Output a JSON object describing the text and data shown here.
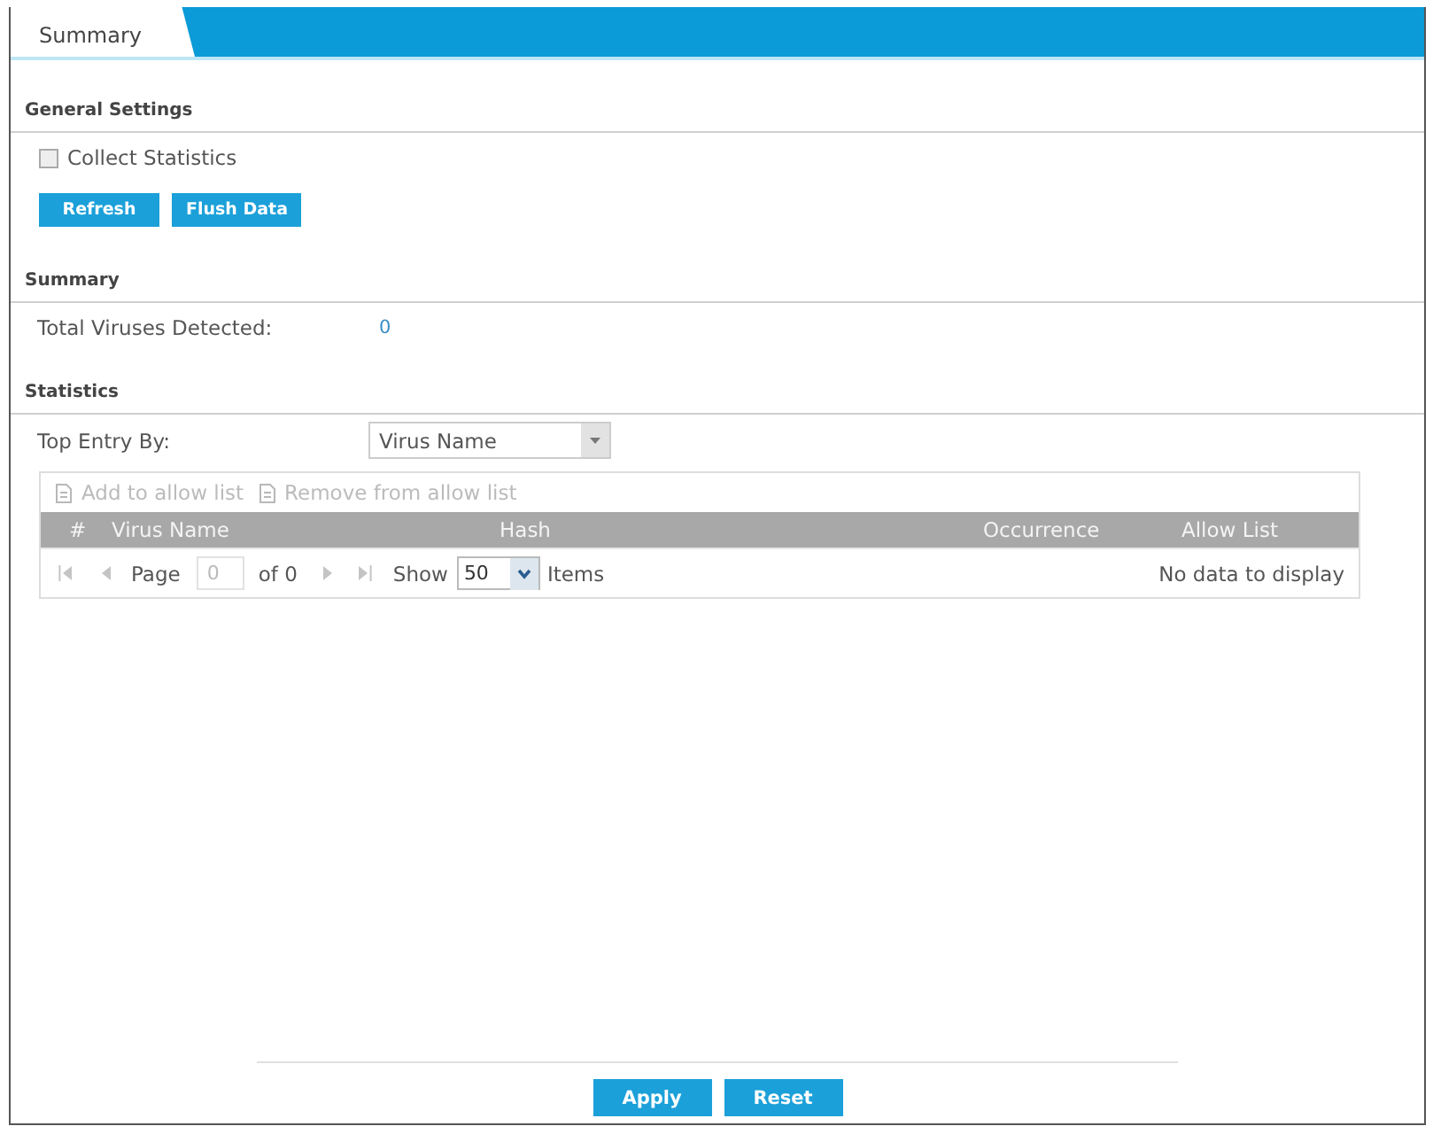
{
  "tabs": [
    {
      "label": "Summary",
      "selected": true
    }
  ],
  "general_settings": {
    "heading": "General Settings",
    "collect_statistics": {
      "label": "Collect Statistics",
      "checked": false
    },
    "buttons": [
      "Refresh",
      "Flush Data"
    ]
  },
  "summary": {
    "heading": "Summary",
    "fields": [
      {
        "label": "Total Viruses Detected:",
        "value": "0"
      }
    ]
  },
  "statistics": {
    "heading": "Statistics",
    "top_entry_by": {
      "label": "Top Entry By:",
      "value": "Virus Name"
    },
    "table": {
      "toolbar": [
        {
          "label": "Add to allow list",
          "disabled": true
        },
        {
          "label": "Remove from allow list",
          "disabled": true
        }
      ],
      "columns": [
        "#",
        "Virus Name",
        "Hash",
        "Occurrence",
        "Allow List"
      ],
      "pager": {
        "nav_disabled": true,
        "page_label": "Page",
        "page": "0",
        "of": "of 0",
        "show_label": "Show",
        "page_size": "50",
        "items_label": "Items",
        "empty_message": "No data to display"
      }
    }
  },
  "footer_buttons": [
    "Apply",
    "Reset"
  ]
}
